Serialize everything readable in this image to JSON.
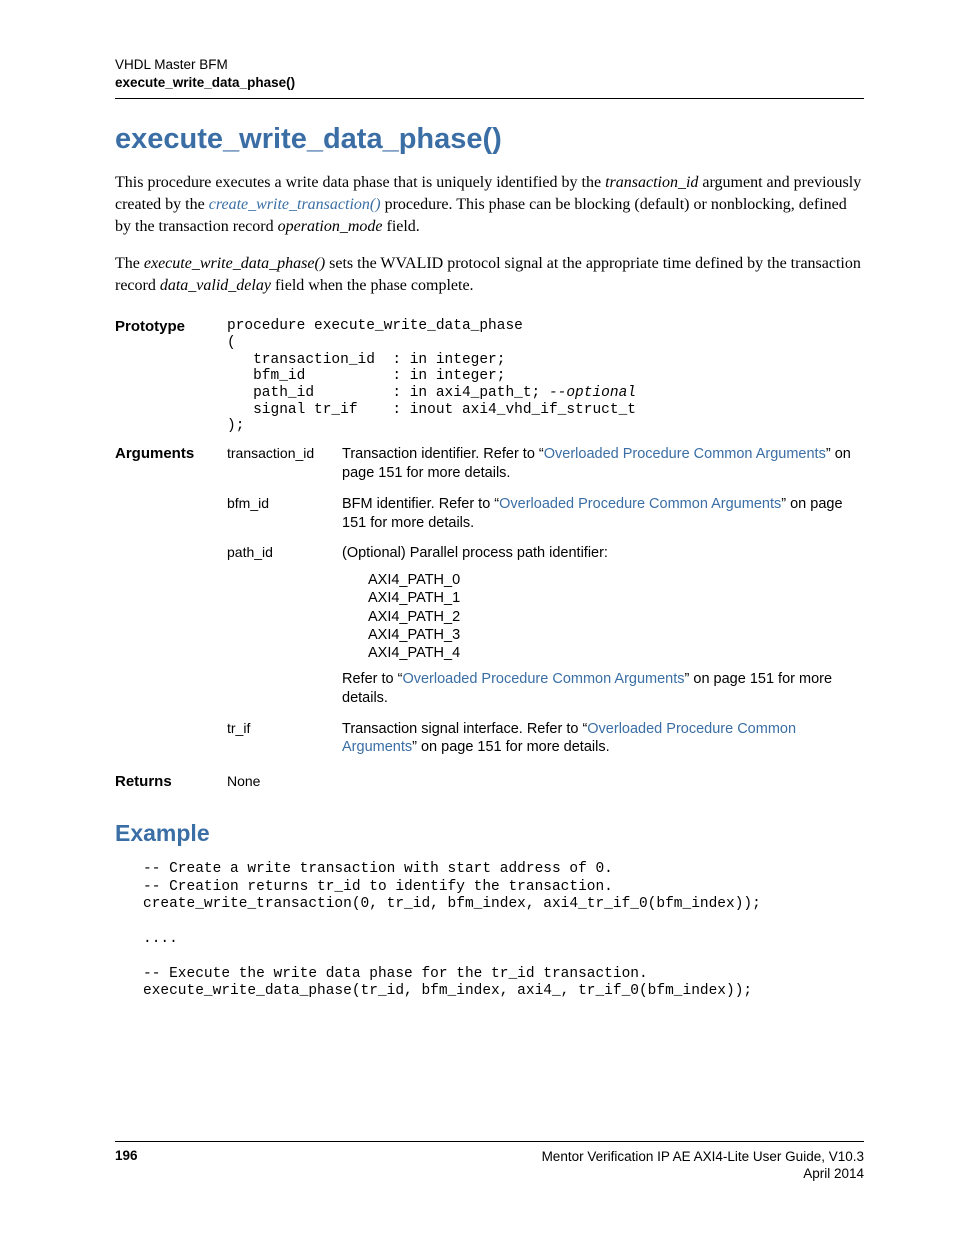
{
  "header": {
    "line1": "VHDL Master BFM",
    "line2": "execute_write_data_phase()"
  },
  "title": "execute_write_data_phase()",
  "para1": {
    "t1": "This procedure executes a write data phase that is uniquely identified by the ",
    "i1": "transaction_id",
    "t2": " argument and previously created by the ",
    "link1": "create_write_transaction()",
    "t3": " procedure. This phase can be blocking (default) or nonblocking, defined by the transaction record ",
    "i2": "operation_mode",
    "t4": " field."
  },
  "para2": {
    "t1": "The ",
    "i1": "execute_write_data_phase()",
    "t2": " sets the WVALID protocol signal at the appropriate time defined by the transaction record ",
    "i2": "data_valid_delay",
    "t3": " field when the phase complete."
  },
  "prototype": {
    "label": "Prototype",
    "code_prefix": "procedure execute_write_data_phase\n(\n   transaction_id  : in integer;\n   bfm_id          : in integer;\n   path_id         : in axi4_path_t; ",
    "code_opt": "--optional",
    "code_suffix": "\n   signal tr_if    : inout axi4_vhd_if_struct_t\n);"
  },
  "arguments": {
    "label": "Arguments",
    "rows": [
      {
        "name": "transaction_id",
        "desc_pre": "Transaction identifier. Refer to “",
        "link": "Overloaded Procedure Common Arguments",
        "desc_post": "” on page 151 for more details."
      },
      {
        "name": "bfm_id",
        "desc_pre": "BFM identifier. Refer to “",
        "link": "Overloaded Procedure Common Arguments",
        "desc_post": "” on page 151 for more details."
      },
      {
        "name": "path_id",
        "desc_intro": "(Optional) Parallel process path identifier:",
        "paths": [
          "AXI4_PATH_0",
          "AXI4_PATH_1",
          "AXI4_PATH_2",
          "AXI4_PATH_3",
          "AXI4_PATH_4"
        ],
        "desc_pre": "Refer to “",
        "link": "Overloaded Procedure Common Arguments",
        "desc_post": "” on page 151 for more details."
      },
      {
        "name": "tr_if",
        "desc_pre": "Transaction signal interface. Refer to “",
        "link": "Overloaded Procedure Common Arguments",
        "desc_post": "” on page 151 for more details."
      }
    ]
  },
  "returns": {
    "label": "Returns",
    "value": "None"
  },
  "example": {
    "heading": "Example",
    "code": "-- Create a write transaction with start address of 0.\n-- Creation returns tr_id to identify the transaction.\ncreate_write_transaction(0, tr_id, bfm_index, axi4_tr_if_0(bfm_index));\n\n....\n\n-- Execute the write data phase for the tr_id transaction.\nexecute_write_data_phase(tr_id, bfm_index, axi4_, tr_if_0(bfm_index));"
  },
  "footer": {
    "page": "196",
    "right1": "Mentor Verification IP AE AXI4-Lite User Guide, V10.3",
    "right2": "April 2014"
  }
}
